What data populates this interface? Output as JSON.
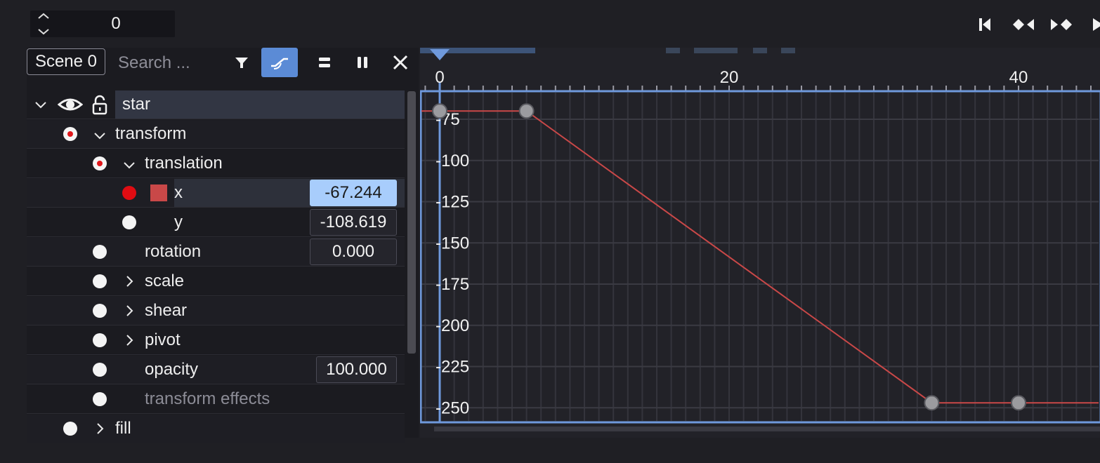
{
  "toolbar": {
    "frame_value": "0",
    "frame_stepper_icon": "up-down-chevron-icon",
    "buttons": [
      "skip-to-start-icon",
      "previous-keyframe-icon",
      "next-keyframe-icon",
      "play-icon"
    ]
  },
  "panel": {
    "scene_label": "Scene 0",
    "search_placeholder": "Search ...",
    "icons": [
      "filter-icon",
      "graph-editor-icon",
      "equal-icon",
      "pause-icon",
      "close-icon"
    ]
  },
  "tree": {
    "star": "star",
    "transform": "transform",
    "translation": "translation",
    "x_label": "x",
    "x_value": "-67.244",
    "y_label": "y",
    "y_value": "-108.619",
    "rotation_label": "rotation",
    "rotation_value": "0.000",
    "scale_label": "scale",
    "shear_label": "shear",
    "pivot_label": "pivot",
    "opacity_label": "opacity",
    "opacity_value": "100.000",
    "transform_effects_label": "transform effects",
    "fill_label": "fill"
  },
  "graph": {
    "x_ticks": [
      "0",
      "20",
      "40"
    ],
    "y_ticks": [
      "-75",
      "-100",
      "-125",
      "-150",
      "-175",
      "-200",
      "-225",
      "-250"
    ],
    "curve_color": "#c94848",
    "accent_color": "#5b8bd6",
    "keyframes": [
      {
        "frame": 0,
        "value": -70
      },
      {
        "frame": 6,
        "value": -70
      },
      {
        "frame": 34,
        "value": -247
      },
      {
        "frame": 40,
        "value": -247
      }
    ]
  }
}
